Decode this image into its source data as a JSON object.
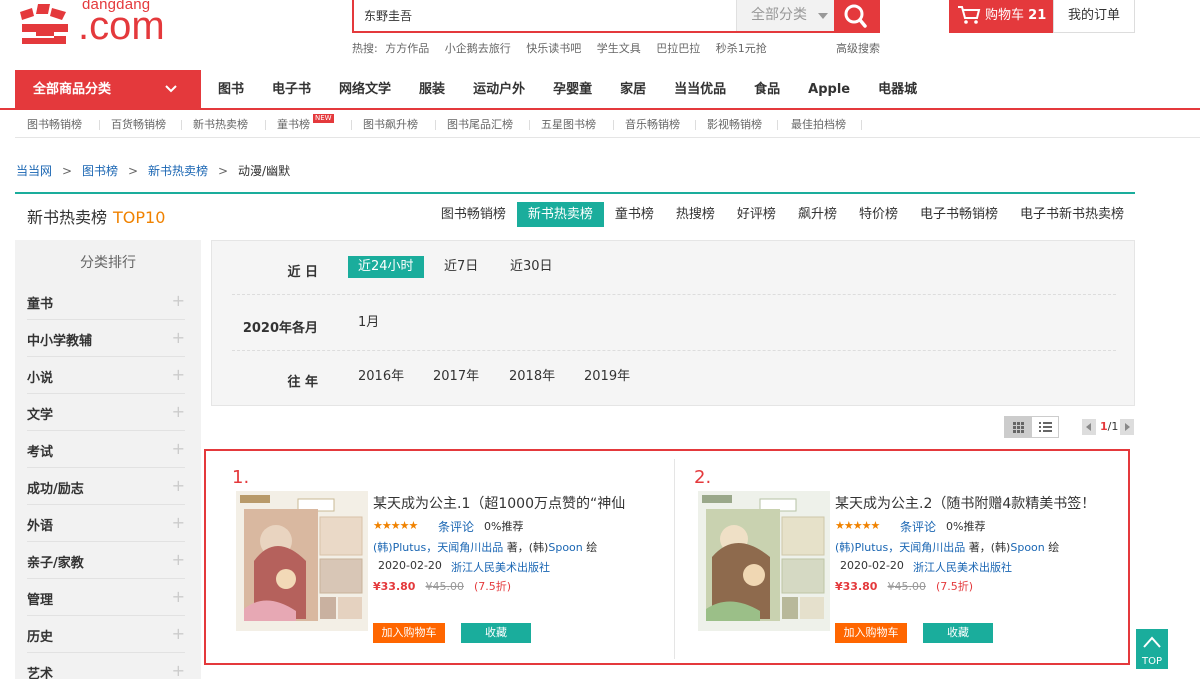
{
  "header": {
    "logo_small": "dangdang",
    "logo_big": ".com",
    "search_value": "东野圭吾",
    "search_category": "全部分类",
    "hot_label": "热搜:",
    "hot_items": [
      "方方作品",
      "小企鹅去旅行",
      "快乐读书吧",
      "学生文具",
      "巴拉巴拉",
      "秒杀1元抢"
    ],
    "advanced_search": "高级搜索",
    "cart_label": "购物车",
    "cart_count": "21",
    "my_orders": "我的订单"
  },
  "nav": {
    "all_categories": "全部商品分类",
    "items": [
      "图书",
      "电子书",
      "网络文学",
      "服装",
      "运动户外",
      "孕婴童",
      "家居",
      "当当优品",
      "食品",
      "Apple",
      "电器城"
    ]
  },
  "subnav": {
    "items": [
      "图书畅销榜",
      "百货畅销榜",
      "新书热卖榜",
      "童书榜",
      "图书飙升榜",
      "图书尾品汇榜",
      "五星图书榜",
      "音乐畅销榜",
      "影视畅销榜",
      "最佳拍档榜"
    ],
    "new_badge": "NEW"
  },
  "breadcrumb": {
    "items": [
      "当当网",
      "图书榜",
      "新书热卖榜"
    ],
    "current": "动漫/幽默"
  },
  "rank": {
    "title": "新书热卖榜",
    "top": "TOP10",
    "tabs": [
      "图书畅销榜",
      "新书热卖榜",
      "童书榜",
      "热搜榜",
      "好评榜",
      "飙升榜",
      "特价榜",
      "电子书畅销榜",
      "电子书新书热卖榜"
    ],
    "active_tab": 1
  },
  "sidebar": {
    "title": "分类排行",
    "items": [
      "童书",
      "中小学教辅",
      "小说",
      "文学",
      "考试",
      "成功/励志",
      "外语",
      "亲子/家教",
      "管理",
      "历史",
      "艺术"
    ]
  },
  "filter": {
    "recent_label": "近 日",
    "recent_options": [
      "近24小时",
      "近7日",
      "近30日"
    ],
    "month_label": "2020年各月",
    "month_options": [
      "1月"
    ],
    "year_label": "往 年",
    "year_options": [
      "2016年",
      "2017年",
      "2018年",
      "2019年"
    ]
  },
  "pager": {
    "current": "1",
    "total": "/1"
  },
  "products": [
    {
      "rank": "1.",
      "title": "某天成为公主.1（超1000万点赞的“神仙",
      "stars": "★★★★★",
      "rating": 5,
      "reviews": "条评论",
      "recommend": "0%推荐",
      "author_main": "(韩)Plutus，天闻角川出品",
      "author_mid": " 著，(韩)",
      "illustrator": "Spoon",
      "author_end": " 绘",
      "date": "2020-02-20",
      "publisher": "浙江人民美术出版社",
      "price": "¥33.80",
      "old_price": "¥45.00",
      "discount": "(7.5折)",
      "add_cart": "加入购物车",
      "favorite": "收藏"
    },
    {
      "rank": "2.",
      "title": "某天成为公主.2（随书附赠4款精美书签！",
      "stars": "★★★★★",
      "rating": 5,
      "reviews": "条评论",
      "recommend": "0%推荐",
      "author_main": "(韩)Plutus，天闻角川出品",
      "author_mid": " 著，(韩)",
      "illustrator": "Spoon",
      "author_end": " 绘",
      "date": "2020-02-20",
      "publisher": "浙江人民美术出版社",
      "price": "¥33.80",
      "old_price": "¥45.00",
      "discount": "(7.5折)",
      "add_cart": "加入购物车",
      "favorite": "收藏"
    }
  ],
  "top_button": "TOP",
  "colors": {
    "brand_red": "#e4393c",
    "teal": "#1aad9c",
    "orange": "#ff6600",
    "link_blue": "#1a66b3"
  }
}
